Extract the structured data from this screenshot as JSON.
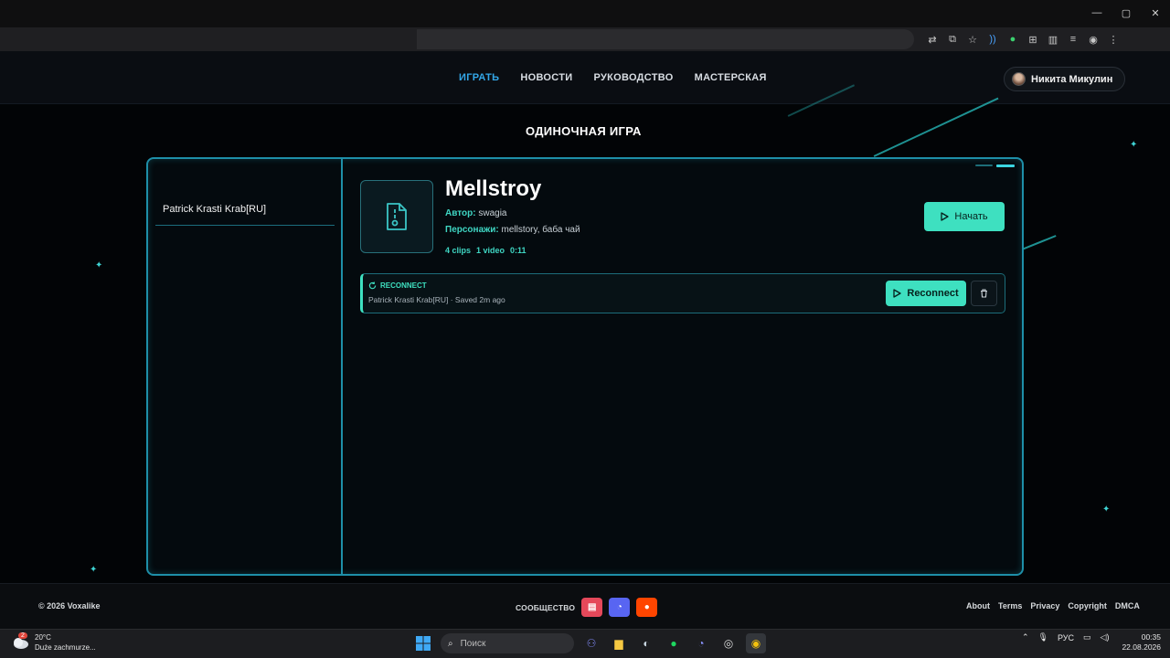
{
  "browser": {
    "window_controls": [
      "—",
      "▢",
      "✕"
    ]
  },
  "site": {
    "nav": [
      {
        "label": "ИГРАТЬ",
        "active": true
      },
      {
        "label": "НОВОСТИ",
        "active": false
      },
      {
        "label": "РУКОВОДСТВО",
        "active": false
      },
      {
        "label": "МАСТЕРСКАЯ",
        "active": false
      }
    ],
    "user_name": "Никита Микулин",
    "page_title": "ОДИНОЧНАЯ ИГРА"
  },
  "sidebar": {
    "items": [
      {
        "label": "Patrick Krasti Krab[RU]"
      }
    ]
  },
  "game": {
    "title": "Mellstroy",
    "author_label": "Автор:",
    "author": "swagia",
    "characters_label": "Персонажи:",
    "characters": "mellstory, баба чай",
    "stats": [
      "4 clips",
      "1 video",
      "0:11"
    ],
    "start_label": "Начать"
  },
  "reconnect": {
    "tag": "RECONNECT",
    "subtitle": "Patrick Krasti Krab[RU] · Saved 2m ago",
    "button_label": "Reconnect"
  },
  "footer": {
    "copyright": "© 2026 Voxalike",
    "community_label": "СООБЩЕСТВО",
    "links": [
      "About",
      "Terms",
      "Privacy",
      "Copyright",
      "DMCA"
    ]
  },
  "taskbar": {
    "weather_temp": "20°C",
    "weather_desc": "Duże zachmurze...",
    "weather_badge": "2",
    "search_placeholder": "Поиск",
    "language": "РУС",
    "time": "00:35",
    "date": "22.08.2026"
  },
  "colors": {
    "accent": "#3ee0c0",
    "nav_active": "#33a7e8",
    "frame_border": "#1e8fa8"
  }
}
